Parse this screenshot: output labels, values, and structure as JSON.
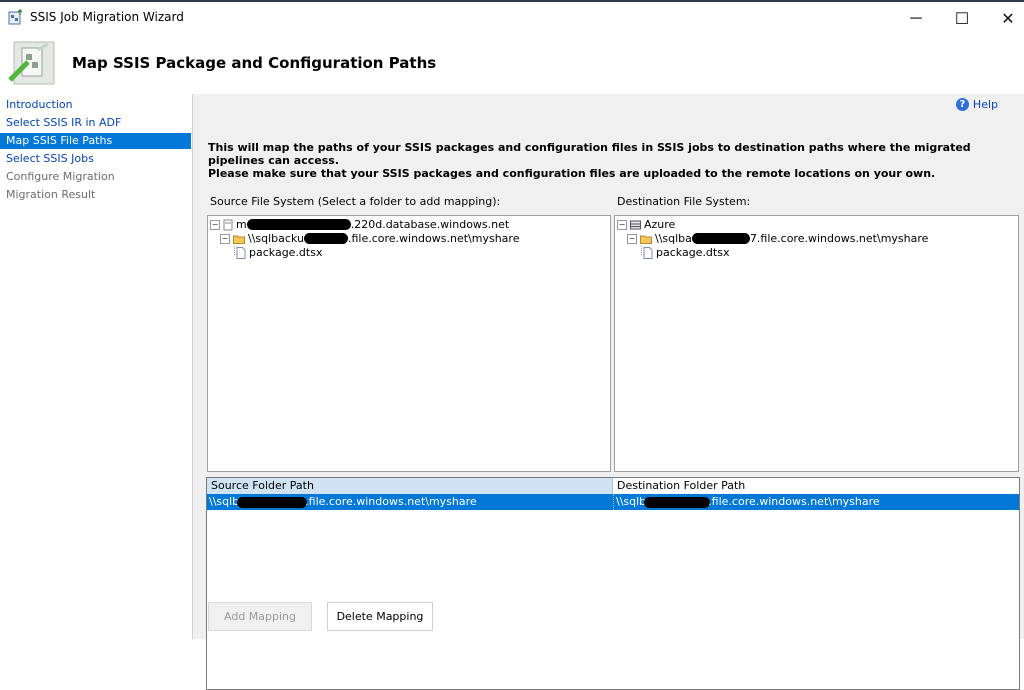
{
  "window": {
    "title": "SSIS Job Migration Wizard",
    "minimize_glyph": "─",
    "maximize_glyph": "☐",
    "close_glyph": "✕"
  },
  "header": {
    "title": "Map SSIS Package and Configuration Paths"
  },
  "sidebar": {
    "items": [
      {
        "label": "Introduction",
        "state": "link"
      },
      {
        "label": "Select SSIS IR in ADF",
        "state": "link"
      },
      {
        "label": "Map SSIS File Paths",
        "state": "active"
      },
      {
        "label": "Select SSIS Jobs",
        "state": "link"
      },
      {
        "label": "Configure Migration",
        "state": "disabled"
      },
      {
        "label": "Migration Result",
        "state": "disabled"
      }
    ]
  },
  "help": {
    "label": "Help",
    "glyph": "?"
  },
  "description": {
    "line1": "This will map the paths of your SSIS packages and configuration files in SSIS jobs to destination paths where the migrated pipelines can access.",
    "line2": "Please make sure that your SSIS packages and configuration files are uploaded to the remote locations on your own."
  },
  "source": {
    "label": "Source File System (Select a folder to add mapping):",
    "root_prefix": "m",
    "root_suffix": ".220d.database.windows.net",
    "folder_prefix": "\\\\sqlbacku",
    "folder_suffix": ".file.core.windows.net\\myshare",
    "file": "package.dtsx"
  },
  "destination": {
    "label": "Destination File System:",
    "root": "Azure",
    "folder_prefix": "\\\\sqlba",
    "folder_suffix": "7.file.core.windows.net\\myshare",
    "file": "package.dtsx"
  },
  "mapping_grid": {
    "columns": [
      "Source Folder Path",
      "Destination Folder Path"
    ],
    "rows": [
      {
        "source_prefix": "\\\\sqlb",
        "source_suffix": ".file.core.windows.net\\myshare",
        "dest_prefix": "\\\\sqlb",
        "dest_suffix": ".file.core.windows.net\\myshare"
      }
    ]
  },
  "buttons": {
    "add_mapping": "Add Mapping",
    "delete_mapping": "Delete Mapping"
  },
  "colors": {
    "accent": "#0078d7",
    "link": "#0645ad",
    "panel": "#f0f0f0"
  }
}
